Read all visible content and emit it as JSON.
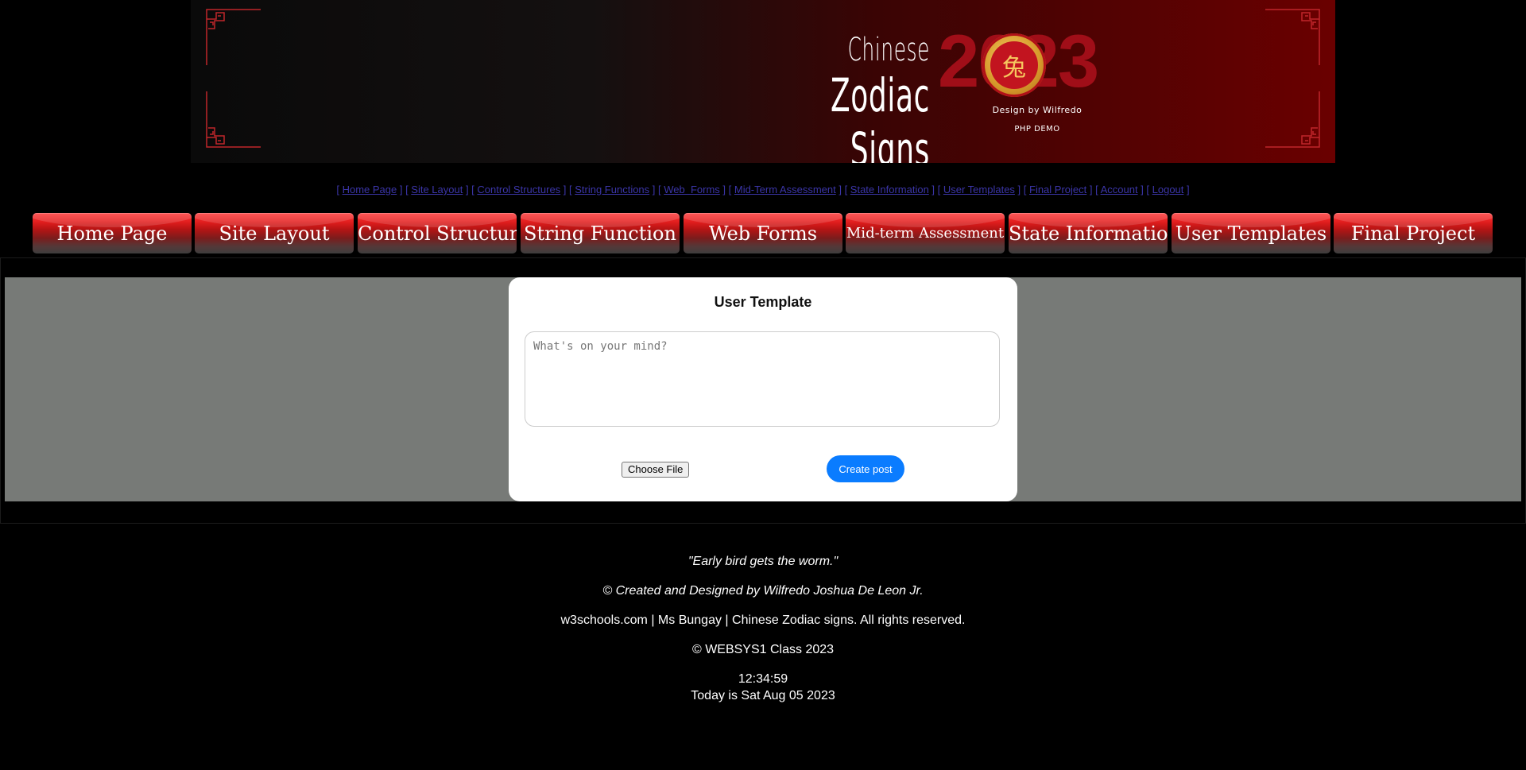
{
  "banner": {
    "title_line1": "Chinese",
    "title_line2": "Zodiac Signs",
    "year": "2023",
    "design_by": "Design by Wilfredo",
    "php_demo": "PHP DEMO",
    "accent_color": "#a00e18"
  },
  "text_nav": [
    "Home Page",
    "Site Layout",
    "Control Structures",
    "String Functions",
    "Web  Forms",
    "Mid-Term Assessment",
    "State Information",
    "User Templates",
    "Final Project",
    "Account",
    "Logout"
  ],
  "button_nav": [
    "Home Page",
    "Site Layout",
    "Control Structure",
    "String Function",
    "Web Forms",
    "Mid-term Assessment",
    "State Information",
    "User Templates",
    "Final Project"
  ],
  "form": {
    "title": "User Template",
    "textarea_placeholder": "What's on your mind?",
    "choose_file_label": "Choose File",
    "submit_label": "Create post",
    "submit_color": "#0a7cff"
  },
  "footer": {
    "quote": "\"Early bird gets the worm.\"",
    "credit": "© Created and Designed by Wilfredo Joshua De Leon Jr.",
    "sources": "w3schools.com | Ms Bungay | Chinese Zodiac signs. All rights reserved.",
    "class": "© WEBSYS1 Class 2023",
    "time": "12:34:59",
    "date": "Today is Sat Aug 05 2023"
  }
}
